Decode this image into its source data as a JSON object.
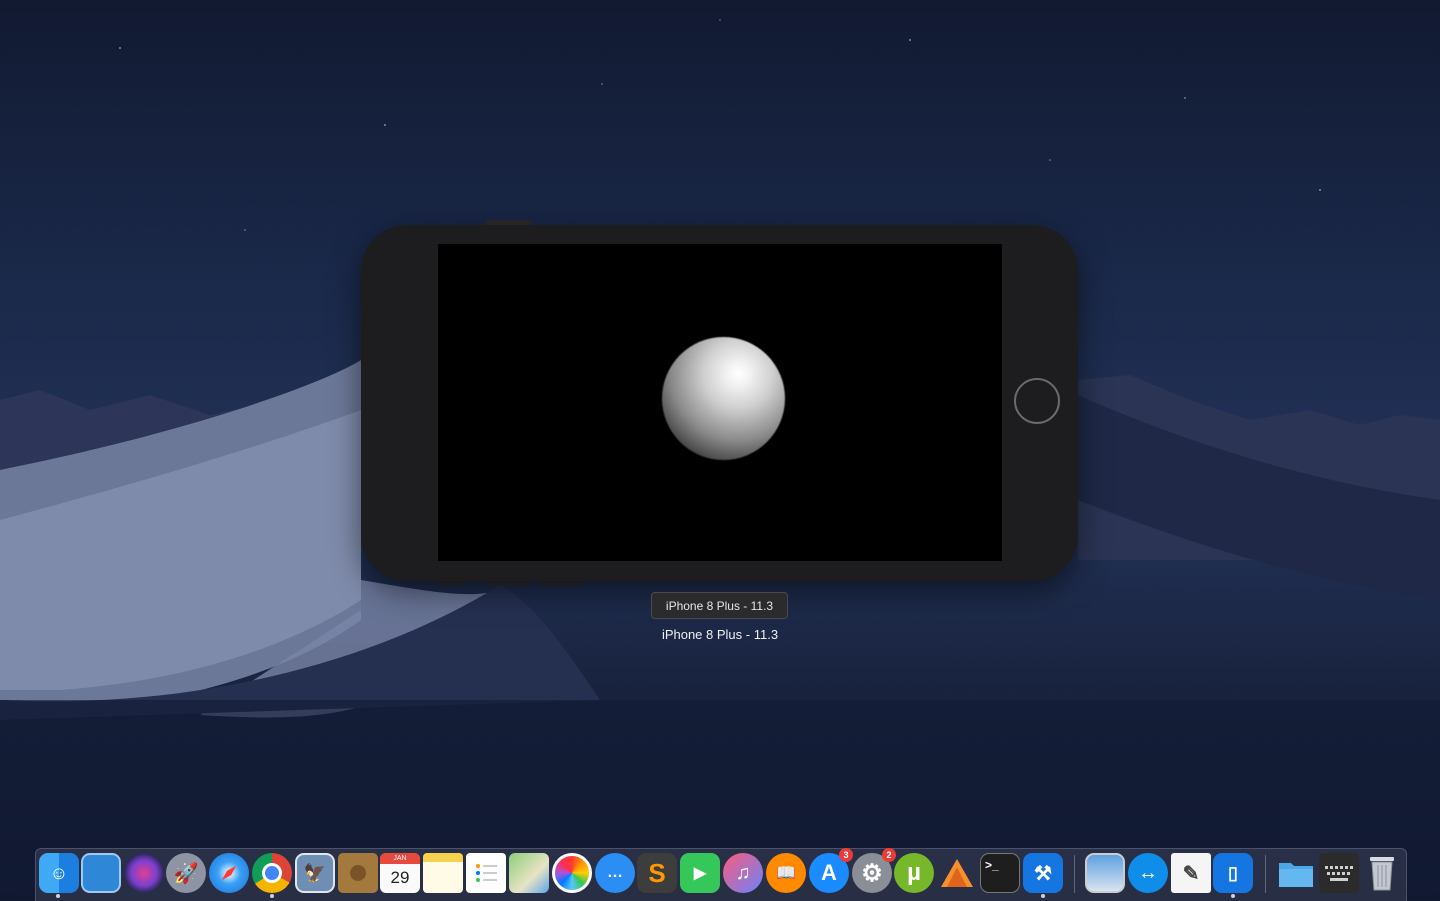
{
  "desktop": {
    "wallpaper": "macOS Mojave night dunes"
  },
  "simulator": {
    "device_tooltip": "iPhone 8 Plus - 11.3",
    "device_label": "iPhone 8 Plus - 11.3"
  },
  "dock": {
    "items": [
      {
        "name": "finder",
        "icon": "finder-icon",
        "badge": ""
      },
      {
        "name": "mission-control",
        "icon": "window-icon",
        "badge": ""
      },
      {
        "name": "siri",
        "icon": "siri-icon",
        "badge": ""
      },
      {
        "name": "launchpad",
        "icon": "rocket-icon",
        "badge": ""
      },
      {
        "name": "safari",
        "icon": "compass-icon",
        "badge": ""
      },
      {
        "name": "chrome",
        "icon": "chrome-icon",
        "badge": ""
      },
      {
        "name": "preview",
        "icon": "eagle-icon",
        "badge": ""
      },
      {
        "name": "contacts",
        "icon": "contacts-icon",
        "badge": ""
      },
      {
        "name": "calendar",
        "icon": "calendar-icon",
        "badge": "",
        "month": "JAN",
        "day": "29"
      },
      {
        "name": "notes",
        "icon": "notes-icon",
        "badge": ""
      },
      {
        "name": "reminders",
        "icon": "list-icon",
        "badge": ""
      },
      {
        "name": "maps",
        "icon": "map-icon",
        "badge": ""
      },
      {
        "name": "photos",
        "icon": "photos-icon",
        "badge": ""
      },
      {
        "name": "messages",
        "icon": "chat-icon",
        "badge": ""
      },
      {
        "name": "sublime-text",
        "icon": "sublime-icon",
        "badge": ""
      },
      {
        "name": "facetime",
        "icon": "video-icon",
        "badge": ""
      },
      {
        "name": "itunes",
        "icon": "music-icon",
        "badge": ""
      },
      {
        "name": "books",
        "icon": "book-icon",
        "badge": ""
      },
      {
        "name": "app-store",
        "icon": "appstore-icon",
        "badge": "3"
      },
      {
        "name": "system-preferences",
        "icon": "gear-icon",
        "badge": "2"
      },
      {
        "name": "utorrent",
        "icon": "torrent-icon",
        "badge": ""
      },
      {
        "name": "git-client",
        "icon": "triangle-icon",
        "badge": ""
      },
      {
        "name": "terminal",
        "icon": "terminal-icon",
        "badge": ""
      },
      {
        "name": "xcode",
        "icon": "hammer-icon",
        "badge": ""
      },
      {
        "name": "image-capture",
        "icon": "photo-search-icon",
        "badge": ""
      },
      {
        "name": "teamviewer",
        "icon": "teamviewer-icon",
        "badge": ""
      },
      {
        "name": "textedit",
        "icon": "pen-paper-icon",
        "badge": ""
      },
      {
        "name": "simulator",
        "icon": "simulator-icon",
        "badge": ""
      },
      {
        "name": "applications-folder",
        "icon": "folder-icon",
        "badge": ""
      },
      {
        "name": "keyboard-viewer",
        "icon": "keyboard-icon",
        "badge": ""
      },
      {
        "name": "trash",
        "icon": "trash-icon",
        "badge": ""
      }
    ]
  }
}
